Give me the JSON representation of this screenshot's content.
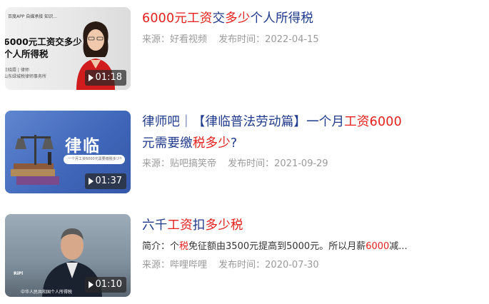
{
  "results": [
    {
      "title_parts": [
        {
          "text": "6000元",
          "hl": true
        },
        {
          "text": "工资",
          "hl": true
        },
        {
          "text": "交",
          "hl": false
        },
        {
          "text": "多少",
          "hl": true
        },
        {
          "text": "个人所得税",
          "hl": false
        }
      ],
      "source": "来源：好看视频",
      "publish": "发布时间：2022-04-15",
      "duration": "01:18",
      "thumb": {
        "top_logos": "百度APP   自媒承接   知识...",
        "title_line1": "6000元工资交多少",
        "title_line2": "个人所得税",
        "byline_line1": "杜晓霞 | 律师",
        "byline_line2": "山东绿城税律师事务所"
      }
    },
    {
      "title_line1_parts": [
        {
          "text": "律师吧｜【律临普法劳动篇】一个月",
          "hl": false
        },
        {
          "text": "工资",
          "hl": true
        },
        {
          "text": "6000",
          "hl": true
        }
      ],
      "title_line2_parts": [
        {
          "text": "元需要缴",
          "hl": false
        },
        {
          "text": "税",
          "hl": true
        },
        {
          "text": "多少",
          "hl": true
        },
        {
          "text": "?",
          "hl": false
        }
      ],
      "source": "来源：贴吧搞笑帝",
      "publish": "发布时间：2021-09-29",
      "duration": "01:37",
      "thumb": {
        "brand": "律临",
        "pill_text": "一个月工资6000元需要缴税多少？"
      }
    },
    {
      "title_parts": [
        {
          "text": "六千",
          "hl": false
        },
        {
          "text": "工资",
          "hl": true
        },
        {
          "text": "扣",
          "hl": false
        },
        {
          "text": "多少",
          "hl": true
        },
        {
          "text": "税",
          "hl": true
        }
      ],
      "snippet_parts": [
        {
          "text": "简介：个",
          "hl": false
        },
        {
          "text": "税",
          "hl": true
        },
        {
          "text": "免征额由3500元提高到5000元。所以月薪",
          "hl": false
        },
        {
          "text": "6000",
          "hl": true
        },
        {
          "text": "减...",
          "hl": false
        }
      ],
      "source": "来源：哔哩哔哩",
      "publish": "发布时间：2020-07-30",
      "duration": "01:10",
      "thumb": {
        "logo": "RiPl",
        "caption": "中华人民共和国个人所得税"
      }
    }
  ],
  "colors": {
    "title": "#1f3a8c",
    "highlight": "#e5201d",
    "meta": "#9a9a9a"
  }
}
